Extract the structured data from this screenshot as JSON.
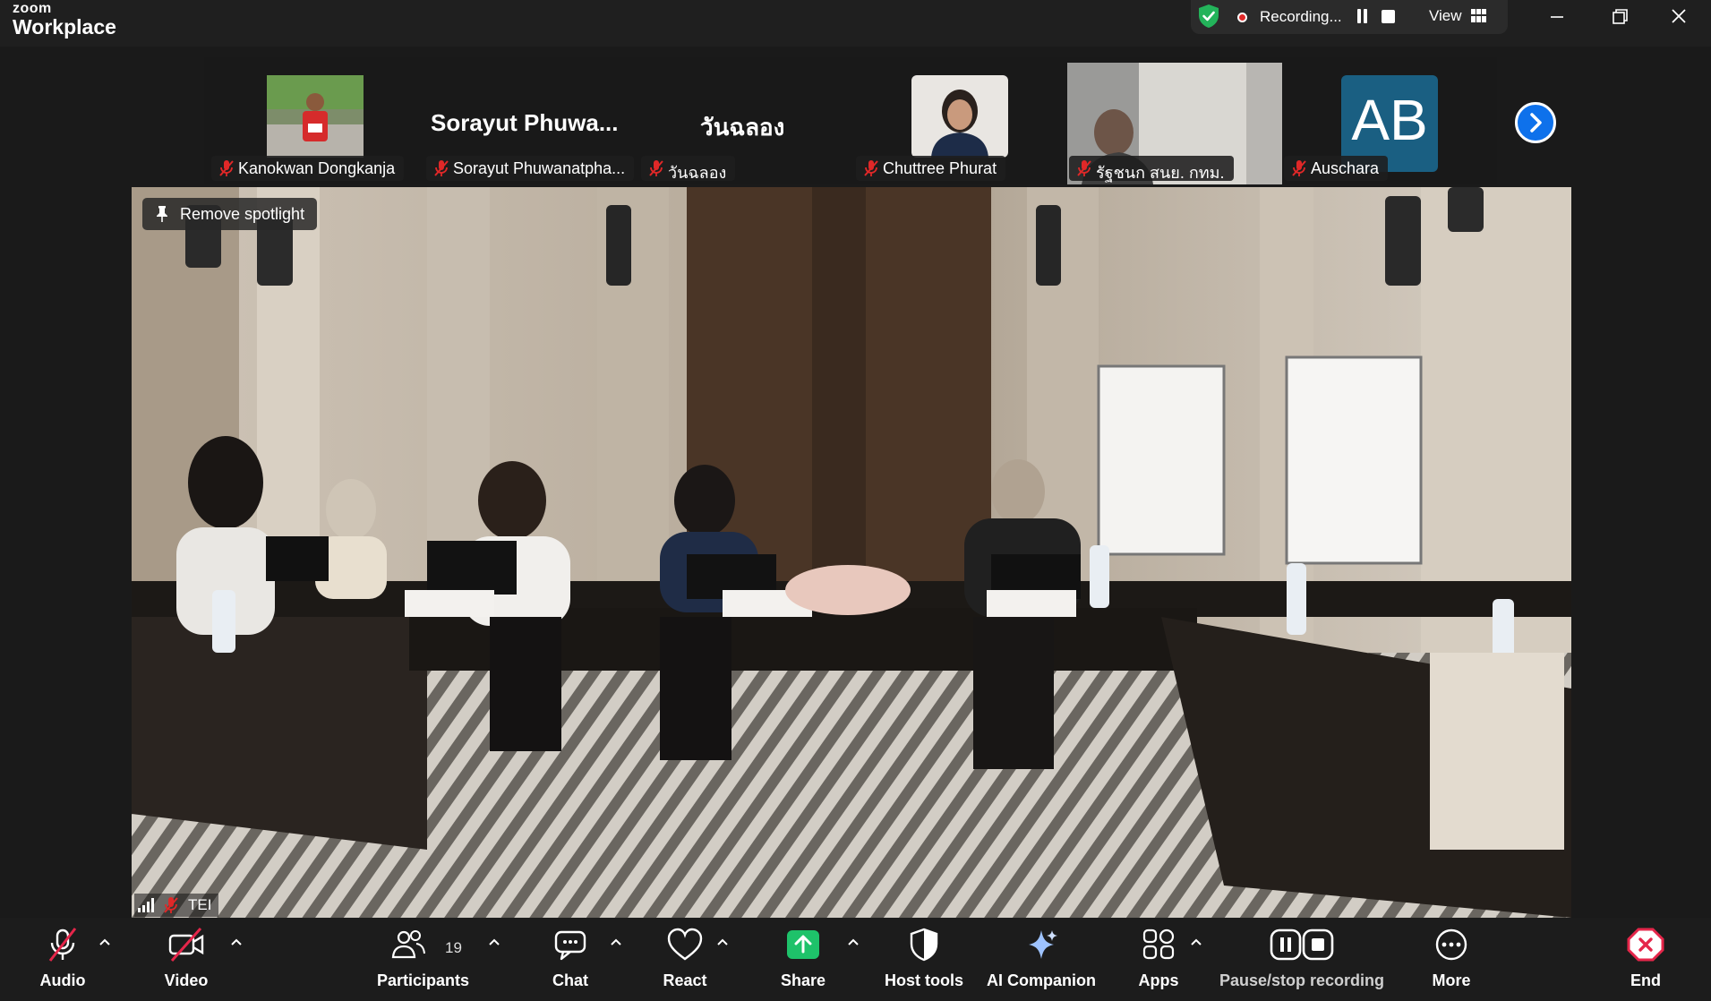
{
  "app": {
    "brand_small": "zoom",
    "brand_big": "Workplace"
  },
  "recording": {
    "label": "Recording...",
    "view_label": "View"
  },
  "gallery": {
    "tiles": [
      {
        "name": "Kanokwan Dongkanja"
      },
      {
        "display": "Sorayut  Phuwa...",
        "name": "Sorayut Phuwanatpha..."
      },
      {
        "display": "วันฉลอง",
        "name": "วันฉลอง"
      },
      {
        "name": "Chuttree Phurat"
      },
      {
        "name": "รัฐชนก สนย. กทม."
      },
      {
        "initials": "AB",
        "name": "Auschara"
      }
    ]
  },
  "main": {
    "spotlight_label": "Remove spotlight",
    "speaker": "TEI"
  },
  "toolbar": {
    "audio": "Audio",
    "video": "Video",
    "participants": "Participants",
    "participant_count": "19",
    "chat": "Chat",
    "react": "React",
    "share": "Share",
    "host_tools": "Host tools",
    "ai_companion": "AI Companion",
    "apps": "Apps",
    "pause_recording": "Pause/stop recording",
    "more": "More",
    "end": "End"
  },
  "colors": {
    "accent": "#0e71eb",
    "end": "#e5264a",
    "share": "#1ec26a",
    "shield": "#23b35a",
    "rec": "#e02828"
  }
}
